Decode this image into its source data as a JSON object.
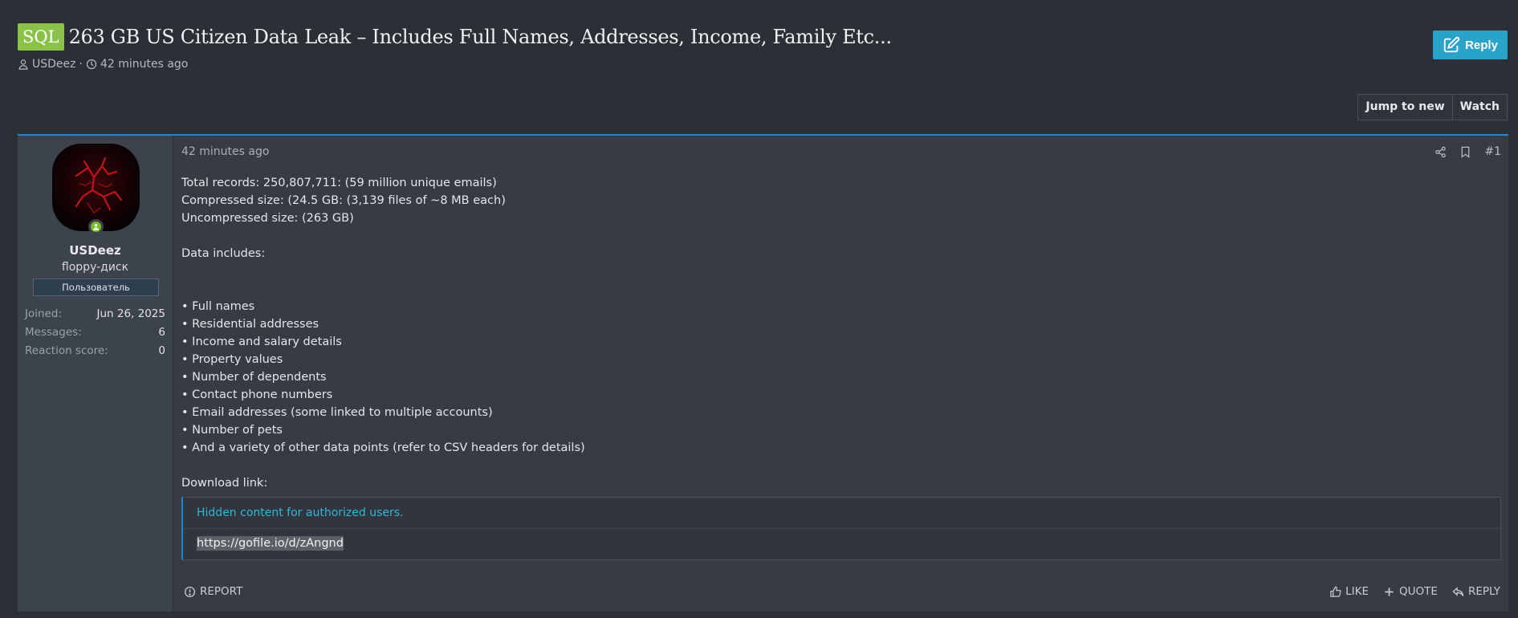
{
  "thread": {
    "prefix": "SQL",
    "title": "263 GB US Citizen Data Leak – Includes Full Names, Addresses, Income, Family Etc...",
    "author": "USDeez",
    "meta_separator": "·",
    "time": "42 minutes ago"
  },
  "buttons": {
    "reply": "Reply",
    "jump_to_new": "Jump to new",
    "watch": "Watch"
  },
  "post": {
    "user": {
      "name": "USDeez",
      "title": "floppy-диск",
      "banner": "Пользователь",
      "stats": [
        {
          "label": "Joined:",
          "value": "Jun 26, 2025"
        },
        {
          "label": "Messages:",
          "value": "6"
        },
        {
          "label": "Reaction score:",
          "value": "0"
        }
      ]
    },
    "date": "42 minutes ago",
    "number": "#1",
    "lines": {
      "l1": "Total records: 250,807,711: (59 million unique emails)",
      "l2": "Compressed size: (24.5 GB: (3,139 files of ~8 MB each)",
      "l3": "Uncompressed size: (263 GB)",
      "l4": "Data includes:",
      "b1": "• Full names",
      "b2": "• Residential addresses",
      "b3": "• Income and salary details",
      "b4": "• Property values",
      "b5": "• Number of dependents",
      "b6": "• Contact phone numbers",
      "b7": "• Email addresses (some linked to multiple accounts)",
      "b8": "• Number of pets",
      "b9": "• And a variety of other data points (refer to CSV headers for details)",
      "l5": "Download link:"
    },
    "hidden": {
      "header": "Hidden content for authorized users.",
      "link": "https://gofile.io/d/zAngnd"
    },
    "footer": {
      "report": "REPORT",
      "like": "LIKE",
      "quote": "QUOTE",
      "reply": "REPLY"
    }
  },
  "colors": {
    "prefix_bg": "#8bc34a",
    "accent": "#2aa3c9",
    "post_border": "#1f86d6",
    "online": "#7cba2f"
  },
  "icons": [
    "user-icon",
    "clock-icon",
    "edit-icon",
    "share-icon",
    "bookmark-icon",
    "report-icon",
    "like-icon",
    "quote-icon",
    "reply-icon"
  ]
}
